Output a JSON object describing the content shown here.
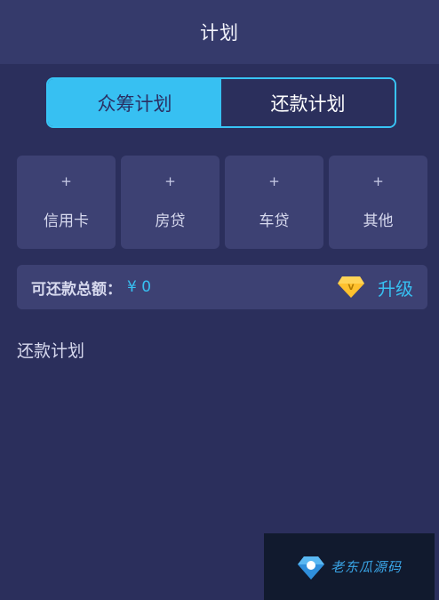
{
  "header": {
    "title": "计划"
  },
  "tabs": [
    {
      "label": "众筹计划",
      "active": true
    },
    {
      "label": "还款计划",
      "active": false
    }
  ],
  "categories": [
    {
      "plus": "+",
      "label": "信用卡"
    },
    {
      "plus": "+",
      "label": "房贷"
    },
    {
      "plus": "+",
      "label": "车贷"
    },
    {
      "plus": "+",
      "label": "其他"
    }
  ],
  "summary": {
    "label": "可还款总额：",
    "value": "¥ 0",
    "upgrade_icon": "diamond-icon",
    "upgrade_label": "升级"
  },
  "section": {
    "title": "还款计划"
  },
  "watermark": {
    "text": "老东瓜源码",
    "icon": "logo-icon"
  },
  "colors": {
    "background": "#2b2f5c",
    "header": "#353a6b",
    "card": "#3d4173",
    "accent": "#37c0f2",
    "diamond": "#ffc12e"
  }
}
